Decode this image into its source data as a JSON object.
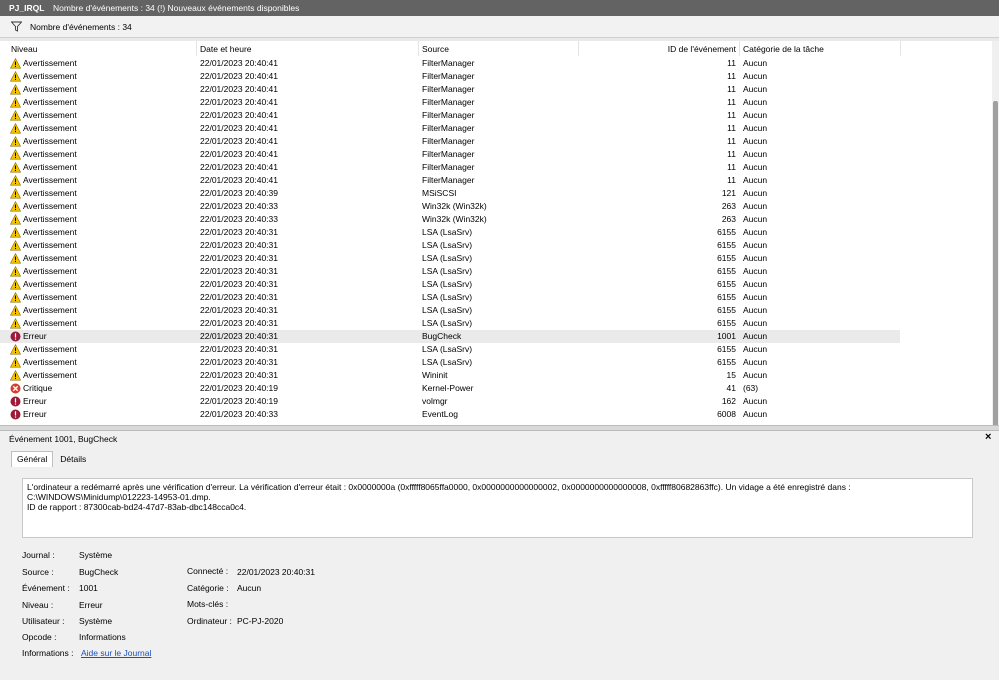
{
  "titlebar": {
    "name": "PJ_IRQL",
    "info": "Nombre d'événements : 34 (!) Nouveaux événements disponibles"
  },
  "filterbar": {
    "count_label": "Nombre d'événements : 34"
  },
  "columns": {
    "niveau": "Niveau",
    "date": "Date et heure",
    "source": "Source",
    "id": "ID de l'événement",
    "categorie": "Catégorie de la tâche"
  },
  "events": [
    {
      "level": "warning",
      "niveau": "Avertissement",
      "date": "22/01/2023 20:40:41",
      "source": "FilterManager",
      "id": "11",
      "categorie": "Aucun"
    },
    {
      "level": "warning",
      "niveau": "Avertissement",
      "date": "22/01/2023 20:40:41",
      "source": "FilterManager",
      "id": "11",
      "categorie": "Aucun"
    },
    {
      "level": "warning",
      "niveau": "Avertissement",
      "date": "22/01/2023 20:40:41",
      "source": "FilterManager",
      "id": "11",
      "categorie": "Aucun"
    },
    {
      "level": "warning",
      "niveau": "Avertissement",
      "date": "22/01/2023 20:40:41",
      "source": "FilterManager",
      "id": "11",
      "categorie": "Aucun"
    },
    {
      "level": "warning",
      "niveau": "Avertissement",
      "date": "22/01/2023 20:40:41",
      "source": "FilterManager",
      "id": "11",
      "categorie": "Aucun"
    },
    {
      "level": "warning",
      "niveau": "Avertissement",
      "date": "22/01/2023 20:40:41",
      "source": "FilterManager",
      "id": "11",
      "categorie": "Aucun"
    },
    {
      "level": "warning",
      "niveau": "Avertissement",
      "date": "22/01/2023 20:40:41",
      "source": "FilterManager",
      "id": "11",
      "categorie": "Aucun"
    },
    {
      "level": "warning",
      "niveau": "Avertissement",
      "date": "22/01/2023 20:40:41",
      "source": "FilterManager",
      "id": "11",
      "categorie": "Aucun"
    },
    {
      "level": "warning",
      "niveau": "Avertissement",
      "date": "22/01/2023 20:40:41",
      "source": "FilterManager",
      "id": "11",
      "categorie": "Aucun"
    },
    {
      "level": "warning",
      "niveau": "Avertissement",
      "date": "22/01/2023 20:40:41",
      "source": "FilterManager",
      "id": "11",
      "categorie": "Aucun"
    },
    {
      "level": "warning",
      "niveau": "Avertissement",
      "date": "22/01/2023 20:40:39",
      "source": "MSiSCSI",
      "id": "121",
      "categorie": "Aucun"
    },
    {
      "level": "warning",
      "niveau": "Avertissement",
      "date": "22/01/2023 20:40:33",
      "source": "Win32k (Win32k)",
      "id": "263",
      "categorie": "Aucun"
    },
    {
      "level": "warning",
      "niveau": "Avertissement",
      "date": "22/01/2023 20:40:33",
      "source": "Win32k (Win32k)",
      "id": "263",
      "categorie": "Aucun"
    },
    {
      "level": "warning",
      "niveau": "Avertissement",
      "date": "22/01/2023 20:40:31",
      "source": "LSA (LsaSrv)",
      "id": "6155",
      "categorie": "Aucun"
    },
    {
      "level": "warning",
      "niveau": "Avertissement",
      "date": "22/01/2023 20:40:31",
      "source": "LSA (LsaSrv)",
      "id": "6155",
      "categorie": "Aucun"
    },
    {
      "level": "warning",
      "niveau": "Avertissement",
      "date": "22/01/2023 20:40:31",
      "source": "LSA (LsaSrv)",
      "id": "6155",
      "categorie": "Aucun"
    },
    {
      "level": "warning",
      "niveau": "Avertissement",
      "date": "22/01/2023 20:40:31",
      "source": "LSA (LsaSrv)",
      "id": "6155",
      "categorie": "Aucun"
    },
    {
      "level": "warning",
      "niveau": "Avertissement",
      "date": "22/01/2023 20:40:31",
      "source": "LSA (LsaSrv)",
      "id": "6155",
      "categorie": "Aucun"
    },
    {
      "level": "warning",
      "niveau": "Avertissement",
      "date": "22/01/2023 20:40:31",
      "source": "LSA (LsaSrv)",
      "id": "6155",
      "categorie": "Aucun"
    },
    {
      "level": "warning",
      "niveau": "Avertissement",
      "date": "22/01/2023 20:40:31",
      "source": "LSA (LsaSrv)",
      "id": "6155",
      "categorie": "Aucun"
    },
    {
      "level": "warning",
      "niveau": "Avertissement",
      "date": "22/01/2023 20:40:31",
      "source": "LSA (LsaSrv)",
      "id": "6155",
      "categorie": "Aucun"
    },
    {
      "level": "error",
      "niveau": "Erreur",
      "date": "22/01/2023 20:40:31",
      "source": "BugCheck",
      "id": "1001",
      "categorie": "Aucun",
      "selected": true
    },
    {
      "level": "warning",
      "niveau": "Avertissement",
      "date": "22/01/2023 20:40:31",
      "source": "LSA (LsaSrv)",
      "id": "6155",
      "categorie": "Aucun"
    },
    {
      "level": "warning",
      "niveau": "Avertissement",
      "date": "22/01/2023 20:40:31",
      "source": "LSA (LsaSrv)",
      "id": "6155",
      "categorie": "Aucun"
    },
    {
      "level": "warning",
      "niveau": "Avertissement",
      "date": "22/01/2023 20:40:31",
      "source": "Wininit",
      "id": "15",
      "categorie": "Aucun"
    },
    {
      "level": "critical",
      "niveau": "Critique",
      "date": "22/01/2023 20:40:19",
      "source": "Kernel-Power",
      "id": "41",
      "categorie": "(63)"
    },
    {
      "level": "error",
      "niveau": "Erreur",
      "date": "22/01/2023 20:40:19",
      "source": "volmgr",
      "id": "162",
      "categorie": "Aucun"
    },
    {
      "level": "error",
      "niveau": "Erreur",
      "date": "22/01/2023 20:40:33",
      "source": "EventLog",
      "id": "6008",
      "categorie": "Aucun"
    }
  ],
  "detail": {
    "title": "Événement 1001, BugCheck",
    "close": "×",
    "tabs": [
      "Général",
      "Détails"
    ],
    "description_line1": "L'ordinateur a redémarré après une vérification d'erreur. La vérification d'erreur était : 0x0000000a (0xfffff8065ffa0000, 0x0000000000000002, 0x0000000000000008, 0xfffff80682863ffc). Un vidage a été enregistré dans : C:\\WINDOWS\\Minidump\\012223-14953-01.dmp.",
    "description_line2": "ID de rapport : 87300cab-bd24-47d7-83ab-dbc148cca0c4.",
    "fields": {
      "journal_label": "Journal :",
      "journal_value": "Système",
      "source_label": "Source :",
      "source_value": "BugCheck",
      "connecte_label": "Connecté :",
      "connecte_value": "22/01/2023 20:40:31",
      "evenement_label": "Événement :",
      "evenement_value": "1001",
      "categorie_label": "Catégorie :",
      "categorie_value": "Aucun",
      "niveau_label": "Niveau :",
      "niveau_value": "Erreur",
      "motscles_label": "Mots-clés :",
      "motscles_value": "",
      "utilisateur_label": "Utilisateur :",
      "utilisateur_value": "Système",
      "ordinateur_label": "Ordinateur :",
      "ordinateur_value": "PC-PJ-2020",
      "opcode_label": "Opcode :",
      "opcode_value": "Informations",
      "informations_label": "Informations :",
      "informations_link": "Aide sur le Journal"
    }
  },
  "colors": {
    "warning": "#f5c400",
    "error": "#9b1b3a",
    "critical": "#d63d2e",
    "link": "#1a4fbf"
  }
}
